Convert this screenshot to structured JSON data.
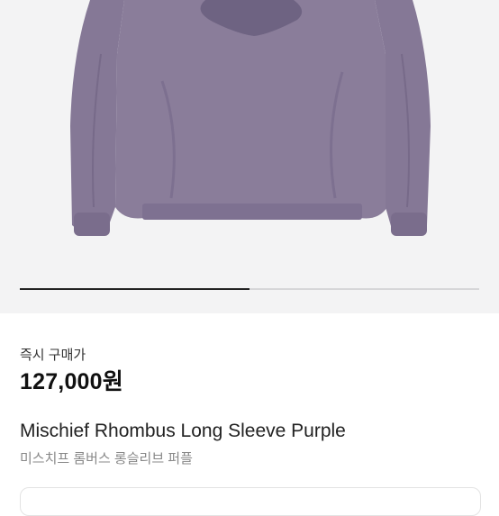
{
  "product": {
    "image_icon": "purple-long-sleeve-shirt-image",
    "carousel_progress": 0.5,
    "buy_label": "즉시 구매가",
    "price": "127,000원",
    "name_en": "Mischief Rhombus Long Sleeve Purple",
    "name_ko": "미스치프 롬버스 롱슬리브 퍼플"
  },
  "colors": {
    "shirt": "#8a7d9a",
    "shirt_shadow": "#6e6382",
    "background": "#f3f3f4",
    "price_text": "#111111",
    "subtitle_text": "#888888"
  }
}
